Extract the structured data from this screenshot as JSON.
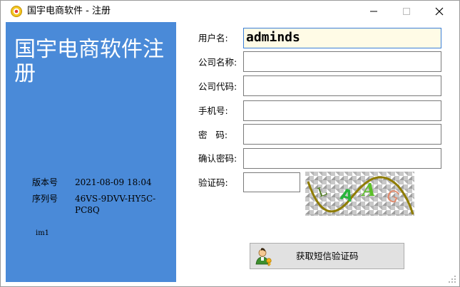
{
  "window": {
    "title": "国宇电商软件 - 注册"
  },
  "brand": {
    "title": "国宇电商软件注册"
  },
  "info": {
    "version_label": "版本号",
    "version_value": "2021-08-09 18:04",
    "serial_label": "序列号",
    "serial_value": "46VS-9DVV-HY5C-PC8Q",
    "im_label": "im1"
  },
  "form": {
    "username_label": "用户名:",
    "username_value": "adminds",
    "company_name_label": "公司名称:",
    "company_code_label": "公司代码:",
    "phone_label": "手机号:",
    "password_label": "密   码:",
    "confirm_password_label": "确认密码:",
    "captcha_label": "验证码:"
  },
  "sms_button": {
    "label": "获取短信验证码"
  },
  "colors": {
    "left_panel": "#4a8ad8",
    "active_input_bg": "#fffbe6"
  }
}
